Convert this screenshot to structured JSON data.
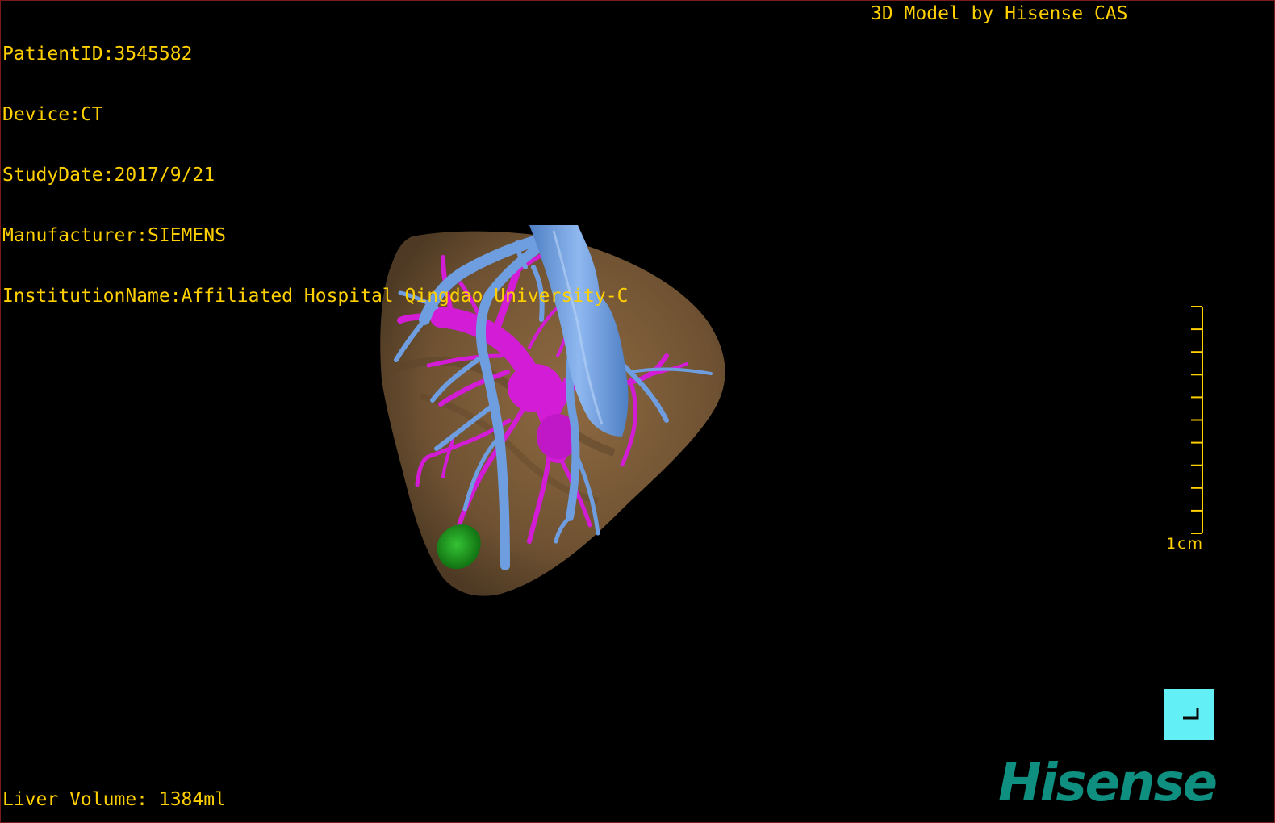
{
  "patient_info": {
    "patient_id": "PatientID:3545582",
    "device": "Device:CT",
    "study_date": "StudyDate:2017/9/21",
    "manufacturer": "Manufacturer:SIEMENS",
    "institution": "InstitutionName:Affiliated Hospital Qingdao University-C"
  },
  "credit": "3D Model by Hisense CAS",
  "liver_volume": "Liver Volume: 1384ml",
  "scale": {
    "label": "1cm"
  },
  "brand": "Hisense",
  "colors": {
    "overlay_text": "#ffd000",
    "liver": "#7a5a38",
    "portal_vein": "#d21cd6",
    "hepatic_vein": "#6e9ee0",
    "tumor": "#1e9a1e",
    "reset_button": "#62f0f6",
    "brand": "#0f8f80"
  }
}
